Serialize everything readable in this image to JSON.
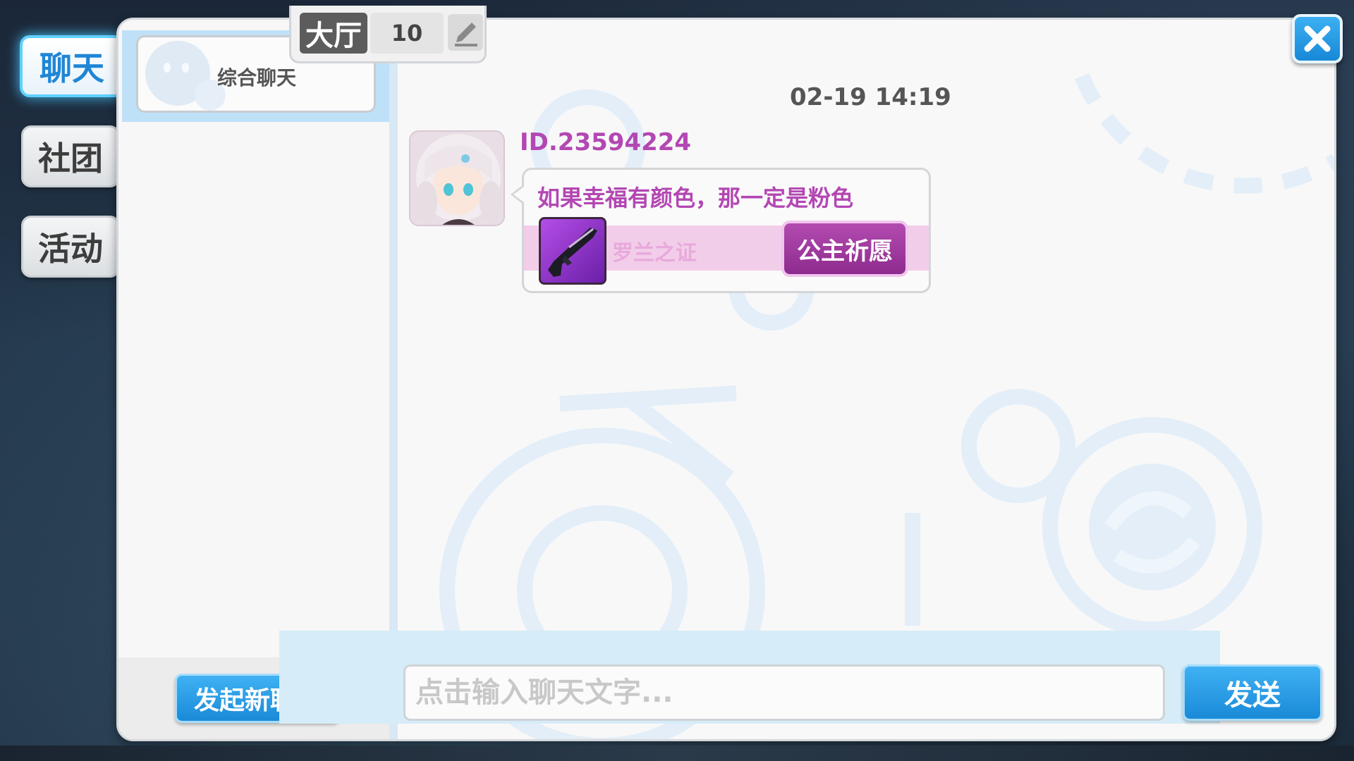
{
  "sidebar": {
    "tabs": [
      {
        "label": "聊天",
        "active": true
      },
      {
        "label": "社团",
        "active": false
      },
      {
        "label": "活动",
        "active": false
      }
    ]
  },
  "channels": {
    "items": [
      {
        "label": "综合聊天",
        "selected": true
      }
    ],
    "new_chat_label": "发起新聊天"
  },
  "chat": {
    "channel_label": "大厅",
    "channel_count": "10",
    "timestamp": "02-19 14:19",
    "messages": [
      {
        "sender": "ID.23594224",
        "text": "如果幸福有颜色，那一定是粉色",
        "item": {
          "name": "罗兰之证",
          "action_label": "公主祈愿"
        }
      }
    ]
  },
  "input": {
    "placeholder": "点击输入聊天文字..."
  },
  "send_label": "发送",
  "icons": {
    "close": "close-icon",
    "edit": "pencil-icon",
    "channel": "chat-bubble-icon",
    "item": "rifle-icon"
  },
  "colors": {
    "accent": "#1a8ad8",
    "username": "#b347b3",
    "wish": "#9a339a",
    "item_bg": "#f2cdea"
  }
}
